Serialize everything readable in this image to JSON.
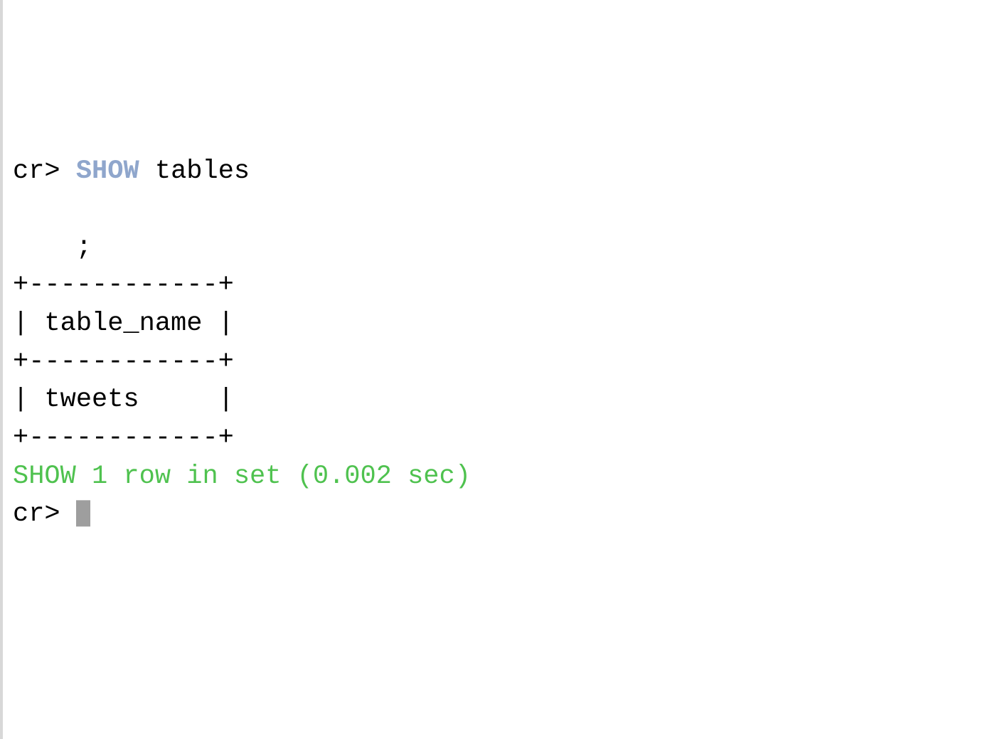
{
  "prompt1": {
    "ps": "cr>",
    "cmd_before_keyword": " ",
    "keyword": "SHOW",
    "cmd_after_keyword": " tables"
  },
  "blank": "",
  "cont_line": "    ;",
  "table": {
    "border_top": "+------------+",
    "header_row": "| table_name |",
    "border_mid": "+------------+",
    "data_row": "| tweets     |",
    "border_bottom": "+------------+"
  },
  "status_line": "SHOW 1 row in set (0.002 sec)",
  "prompt2": {
    "ps": "cr>",
    "space": " "
  }
}
